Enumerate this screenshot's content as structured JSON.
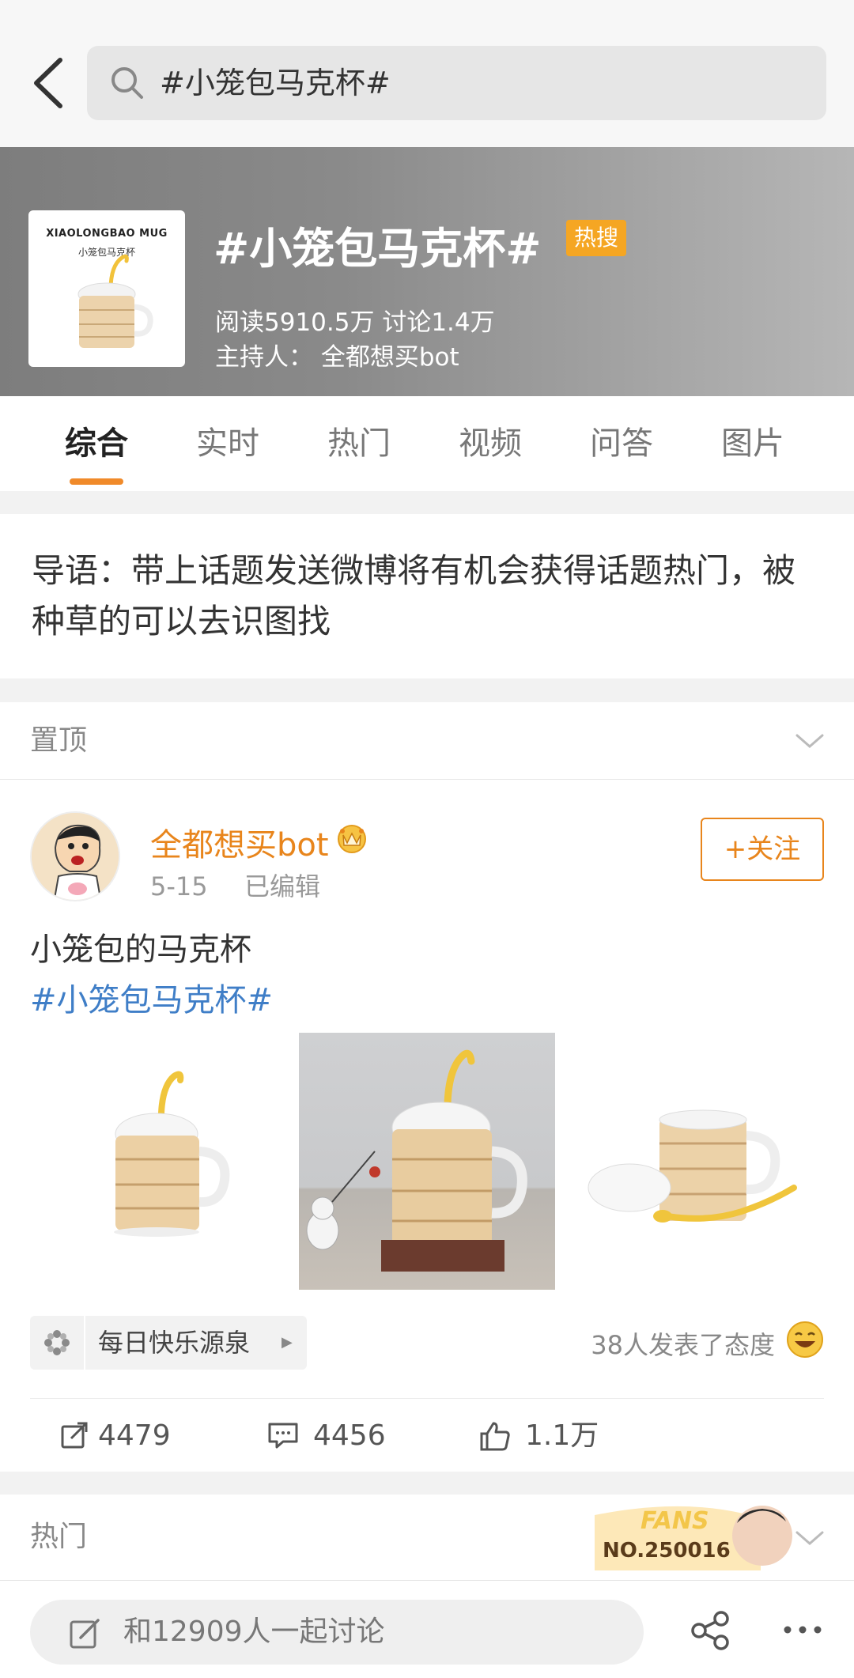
{
  "search": {
    "query": "#小笼包马克杯#"
  },
  "header": {
    "cover_title": "XIAOLONGBAO MUG",
    "cover_subtitle": "小笼包马克杯",
    "title": "#小笼包马克杯#",
    "badge": "热搜",
    "stats": "阅读5910.5万  讨论1.4万",
    "host": "主持人：  全都想买bot"
  },
  "tabs": [
    "综合",
    "实时",
    "热门",
    "视频",
    "问答",
    "图片"
  ],
  "intro": "导语：带上话题发送微博将有机会获得话题热门，被种草的可以去识图找",
  "pinned_label": "置顶",
  "post": {
    "author": "全都想买bot",
    "date": "5-15",
    "edited": "已编辑",
    "follow_label": "+关注",
    "text": "小笼包的马克杯",
    "tag": "#小笼包马克杯#",
    "source": "每日快乐源泉",
    "reactions": "38人发表了态度",
    "reposts": "4479",
    "comments": "4456",
    "likes": "1.1万"
  },
  "hot_label": "热门",
  "fans": {
    "word": "FANS",
    "number": "NO.250016"
  },
  "compose_placeholder": "和12909人一起讨论",
  "colors": {
    "accent": "#e8851c",
    "link": "#3f7ec7",
    "badge": "#f5a623"
  }
}
